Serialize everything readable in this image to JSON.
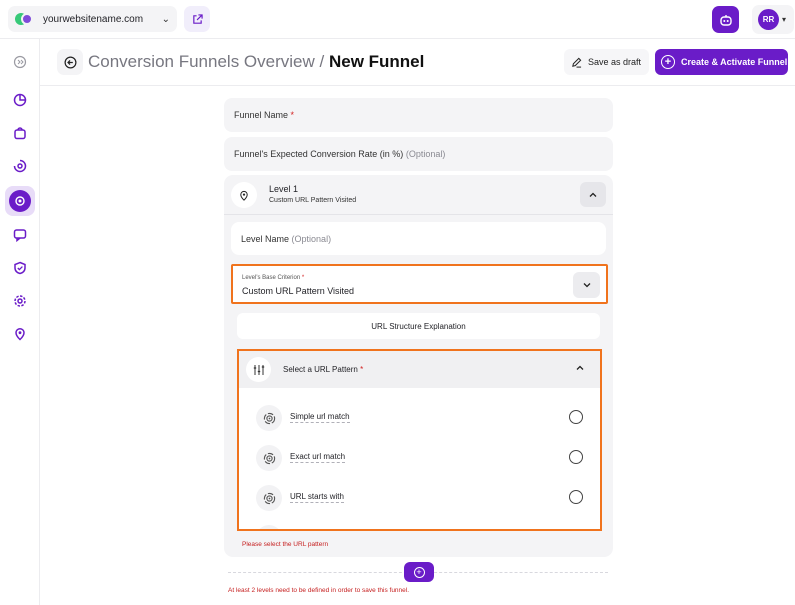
{
  "topbar": {
    "site_name": "yourwebsitename.com",
    "avatar_initials": "RR"
  },
  "sidebar": {
    "items": [
      {
        "icon": "collapse-icon"
      },
      {
        "icon": "dashboard-icon"
      },
      {
        "icon": "shopping-bag-icon"
      },
      {
        "icon": "analytics-icon"
      },
      {
        "icon": "funnel-icon",
        "active": true
      },
      {
        "icon": "chat-icon"
      },
      {
        "icon": "shield-icon"
      },
      {
        "icon": "settings-icon"
      },
      {
        "icon": "location-icon"
      }
    ]
  },
  "header": {
    "breadcrumb_parent": "Conversion Funnels Overview",
    "separator": "/",
    "current": "New Funnel",
    "save_draft_label": "Save as draft",
    "create_label": "Create & Activate Funnel"
  },
  "form": {
    "funnel_name_label": "Funnel Name",
    "funnel_name_req": "*",
    "conversion_rate_label": "Funnel's Expected Conversion Rate (in %)",
    "conversion_rate_opt": "(Optional)",
    "level": {
      "title": "Level 1",
      "subtitle": "Custom URL Pattern Visited",
      "name_label": "Level Name",
      "name_opt": "(Optional)",
      "criterion_label": "Level's Base Criterion",
      "criterion_req": "*",
      "criterion_value": "Custom URL Pattern Visited",
      "explain_label": "URL Structure Explanation",
      "pattern_title": "Select a URL Pattern",
      "pattern_req": "*",
      "pattern_options": [
        "Simple url match",
        "Exact url match",
        "URL starts with"
      ],
      "pattern_error": "Please select the URL pattern"
    },
    "levels_error": "At least 2 levels need to be defined in order to save this funnel."
  },
  "colors": {
    "brand": "#6a1cc8",
    "highlight": "#f0731d",
    "error": "#c62020"
  }
}
